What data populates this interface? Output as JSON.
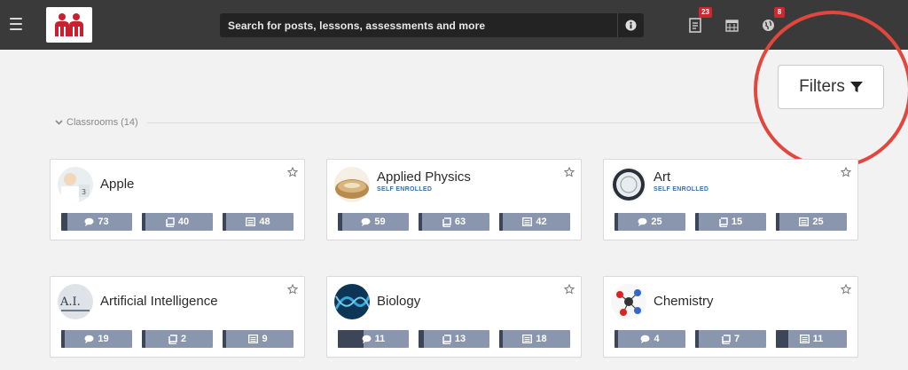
{
  "search": {
    "placeholder": "Search for posts, lessons, assessments and more"
  },
  "notifications": {
    "posts_badge": "23",
    "alerts_badge": "8"
  },
  "filters": {
    "label": "Filters"
  },
  "section": {
    "label": "Classrooms (14)"
  },
  "colors": {
    "brand": "#c8202f",
    "topbar": "#3a3a3a",
    "stat_bar": "#8a96ad",
    "stat_fill": "#3d4558",
    "highlight": "#e2473d"
  },
  "classrooms": [
    {
      "name": "Apple",
      "subtitle": "",
      "thumb_icon": "apple-classroom-thumbnail",
      "stats": [
        {
          "icon": "comment-icon",
          "value": "73",
          "fill": 0.09
        },
        {
          "icon": "book-icon",
          "value": "40",
          "fill": 0.03
        },
        {
          "icon": "list-icon",
          "value": "48",
          "fill": 0.0
        }
      ]
    },
    {
      "name": "Applied Physics",
      "subtitle": "SELF ENROLLED",
      "thumb_icon": "applied-physics-classroom-thumbnail",
      "stats": [
        {
          "icon": "comment-icon",
          "value": "59",
          "fill": 0.06
        },
        {
          "icon": "book-icon",
          "value": "63",
          "fill": 0.03
        },
        {
          "icon": "list-icon",
          "value": "42",
          "fill": 0.0
        }
      ]
    },
    {
      "name": "Art",
      "subtitle": "SELF ENROLLED",
      "thumb_icon": "art-classroom-thumbnail",
      "stats": [
        {
          "icon": "comment-icon",
          "value": "25",
          "fill": 0.0
        },
        {
          "icon": "book-icon",
          "value": "15",
          "fill": 0.0
        },
        {
          "icon": "list-icon",
          "value": "25",
          "fill": 0.03
        }
      ]
    },
    {
      "name": "Artificial Intelligence",
      "subtitle": "",
      "thumb_icon": "artificial-intelligence-classroom-thumbnail",
      "stats": [
        {
          "icon": "comment-icon",
          "value": "19",
          "fill": 0.0
        },
        {
          "icon": "book-icon",
          "value": "2",
          "fill": 0.0
        },
        {
          "icon": "list-icon",
          "value": "9",
          "fill": 0.0
        }
      ]
    },
    {
      "name": "Biology",
      "subtitle": "",
      "thumb_icon": "biology-classroom-thumbnail",
      "stats": [
        {
          "icon": "comment-icon",
          "value": "11",
          "fill": 0.36
        },
        {
          "icon": "book-icon",
          "value": "13",
          "fill": 0.08
        },
        {
          "icon": "list-icon",
          "value": "18",
          "fill": 0.0
        }
      ]
    },
    {
      "name": "Chemistry",
      "subtitle": "",
      "thumb_icon": "chemistry-classroom-thumbnail",
      "stats": [
        {
          "icon": "comment-icon",
          "value": "4",
          "fill": 0.0
        },
        {
          "icon": "book-icon",
          "value": "7",
          "fill": 0.0
        },
        {
          "icon": "list-icon",
          "value": "11",
          "fill": 0.17
        }
      ]
    }
  ]
}
